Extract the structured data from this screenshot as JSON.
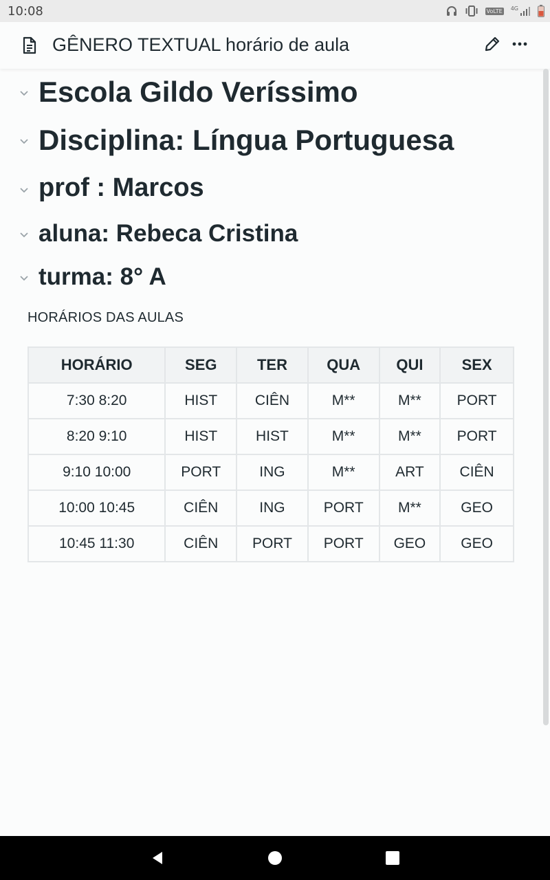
{
  "status_bar": {
    "time": "10:08",
    "network_badge": "VoLTE",
    "network_type": "4G",
    "icons": [
      "headphones-icon",
      "vibrate-icon",
      "volte-icon",
      "signal-icon",
      "battery-icon"
    ]
  },
  "app_bar": {
    "title": "GÊNERO TEXTUAL horário de aula",
    "icons": [
      "document-icon",
      "pencil-edit-icon",
      "more-options-icon"
    ]
  },
  "headings": [
    {
      "text": "Escola Gildo Veríssimo"
    },
    {
      "text": "Disciplina: Língua Portuguesa"
    },
    {
      "text": "prof : Marcos"
    },
    {
      "text": "aluna: Rebeca Cristina"
    },
    {
      "text": "turma: 8° A"
    }
  ],
  "section_label": "HORÁRIOS DAS AULAS",
  "schedule": {
    "headers": [
      "HORÁRIO",
      "SEG",
      "TER",
      "QUA",
      "QUI",
      "SEX"
    ],
    "rows": [
      [
        "7:30 8:20",
        "HIST",
        "CIÊN",
        "M**",
        "M**",
        "PORT"
      ],
      [
        "8:20 9:10",
        "HIST",
        "HIST",
        "M**",
        "M**",
        "PORT"
      ],
      [
        "9:10 10:00",
        "PORT",
        "ING",
        "M**",
        "ART",
        "CIÊN"
      ],
      [
        "10:00 10:45",
        "CIÊN",
        "ING",
        "PORT",
        "M**",
        "GEO"
      ],
      [
        "10:45 11:30",
        "CIÊN",
        "PORT",
        "PORT",
        "GEO",
        "GEO"
      ]
    ]
  },
  "nav_bar": {
    "icons": [
      "back-icon",
      "home-icon",
      "recents-icon"
    ]
  },
  "colors": {
    "text": "#1f2a30",
    "background": "#fbfcfc",
    "table_header_bg": "#f1f3f4",
    "border": "#e3e6e8"
  }
}
